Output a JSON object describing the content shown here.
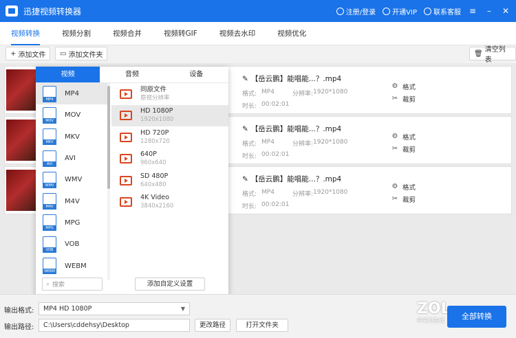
{
  "app": {
    "title": "迅捷视频转换器"
  },
  "title_actions": {
    "login": "注册/登录",
    "vip": "开通VIP",
    "service": "联系客服"
  },
  "tabs": [
    "视频转换",
    "视频分割",
    "视频合并",
    "视频转GIF",
    "视频去水印",
    "视频优化"
  ],
  "toolbar": {
    "add_file": "添加文件",
    "add_folder": "添加文件夹",
    "clear_list": "清空列表"
  },
  "files": [
    {
      "name": "【岳云鹏】能唱能...？.mp4",
      "format_label": "格式:",
      "format": "MP4",
      "res_label": "分辨率:",
      "resolution": "1920*1080",
      "dur_label": "时长:",
      "duration": "00:02:01",
      "op_format": "格式",
      "op_cut": "裁剪"
    },
    {
      "name": "【岳云鹏】能唱能...？.mp4",
      "format_label": "格式:",
      "format": "MP4",
      "res_label": "分辨率:",
      "resolution": "1920*1080",
      "dur_label": "时长:",
      "duration": "00:02:01",
      "op_format": "格式",
      "op_cut": "裁剪"
    },
    {
      "name": "【岳云鹏】能唱能...？.mp4",
      "format_label": "格式:",
      "format": "MP4",
      "res_label": "分辨率:",
      "resolution": "1920*1080",
      "dur_label": "时长:",
      "duration": "00:02:01",
      "op_format": "格式",
      "op_cut": "裁剪"
    }
  ],
  "popup": {
    "tabs": [
      "视频",
      "音频",
      "设备"
    ],
    "formats": [
      "MP4",
      "MOV",
      "MKV",
      "AVI",
      "WMV",
      "M4V",
      "MPG",
      "VOB",
      "WEBM"
    ],
    "qualities": [
      {
        "name": "同原文件",
        "sub": "原视分辨率"
      },
      {
        "name": "HD 1080P",
        "sub": "1920x1080"
      },
      {
        "name": "HD 720P",
        "sub": "1280x720"
      },
      {
        "name": "640P",
        "sub": "960x640"
      },
      {
        "name": "SD 480P",
        "sub": "640x480"
      },
      {
        "name": "4K Video",
        "sub": "3840x2160"
      }
    ],
    "search_placeholder": "搜索",
    "custom_setting": "添加自定义设置"
  },
  "bottom": {
    "output_format_label": "输出格式:",
    "output_format_value": "MP4  HD 1080P",
    "output_path_label": "输出路径:",
    "output_path_value": "C:\\Users\\cddehsy\\Desktop",
    "change_path": "更改路径",
    "open_folder": "打开文件夹",
    "convert_all": "全部转换"
  },
  "watermark": {
    "logo": "ZOL",
    "sub": "中关村在线"
  },
  "colors": {
    "accent": "#1a73e8",
    "quality_icon": "#d9451f"
  }
}
